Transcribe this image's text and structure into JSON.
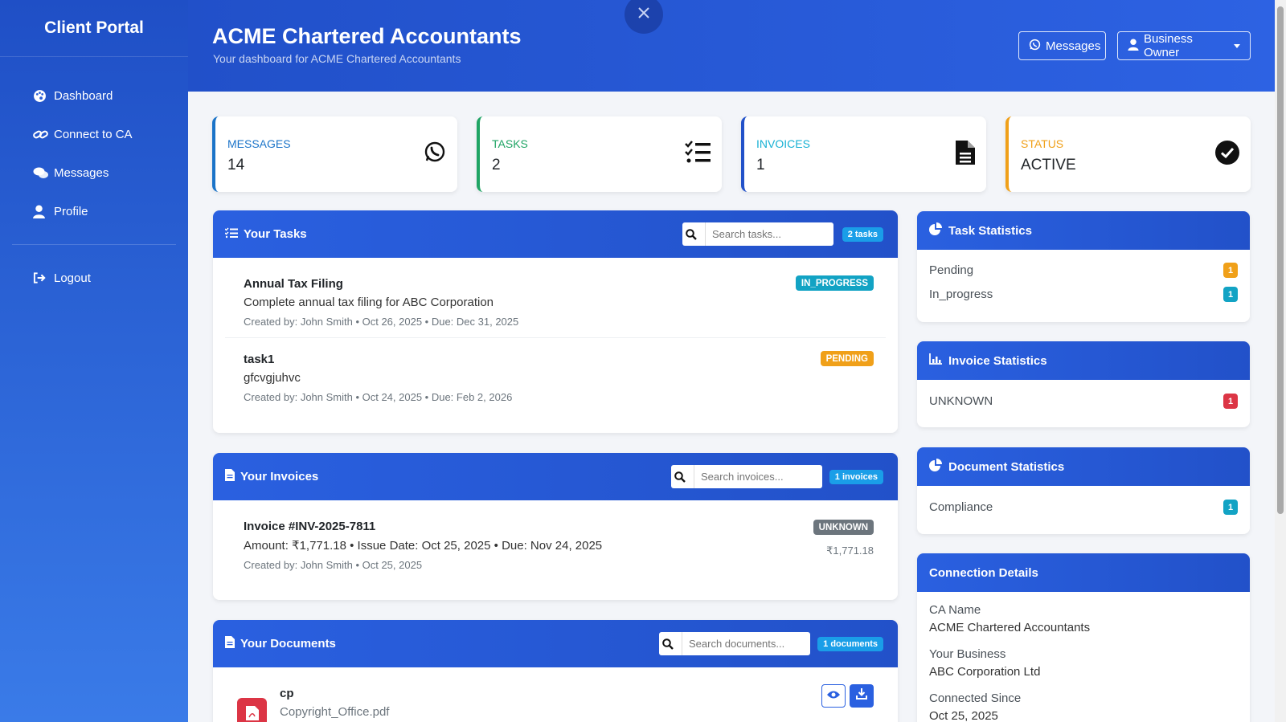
{
  "sidebar": {
    "brand": "Client Portal",
    "items": [
      {
        "label": "Dashboard",
        "icon": "palette-icon"
      },
      {
        "label": "Connect to CA",
        "icon": "link-icon"
      },
      {
        "label": "Messages",
        "icon": "comments-icon"
      },
      {
        "label": "Profile",
        "icon": "user-icon"
      }
    ],
    "logout": "Logout"
  },
  "header": {
    "title": "ACME Chartered Accountants",
    "subtitle": "Your dashboard for ACME Chartered Accountants",
    "messages_btn": "Messages",
    "user_btn": "Business Owner"
  },
  "stats": [
    {
      "label": "MESSAGES",
      "value": "14",
      "color": "#1a73c8",
      "icon": "whatsapp-icon"
    },
    {
      "label": "TASKS",
      "value": "2",
      "color": "#20a565",
      "icon": "tasks-icon"
    },
    {
      "label": "INVOICES",
      "value": "1",
      "color": "#17b1d4",
      "icon": "invoice-icon"
    },
    {
      "label": "STATUS",
      "value": "ACTIVE",
      "color": "#f0a019",
      "icon": "check-circle-icon"
    }
  ],
  "tasks": {
    "title": "Your Tasks",
    "search_placeholder": "Search tasks...",
    "count": "2 tasks",
    "items": [
      {
        "title": "Annual Tax Filing",
        "desc": "Complete annual tax filing for ABC Corporation",
        "meta": "Created by: John Smith • Oct 26, 2025 • Due: Dec 31, 2025",
        "status": "IN_PROGRESS",
        "status_color": "#12a3c4"
      },
      {
        "title": "task1",
        "desc": "gfcvgjuhvc",
        "meta": "Created by: John Smith • Oct 24, 2025 • Due: Feb 2, 2026",
        "status": "PENDING",
        "status_color": "#f0a019"
      }
    ]
  },
  "invoices": {
    "title": "Your Invoices",
    "search_placeholder": "Search invoices...",
    "count": "1 invoices",
    "items": [
      {
        "title": "Invoice #INV-2025-7811",
        "desc": "Amount: ₹1,771.18 • Issue Date: Oct 25, 2025 • Due: Nov 24, 2025",
        "meta": "Created by: John Smith • Oct 25, 2025",
        "status": "UNKNOWN",
        "status_color": "#6c757d",
        "amount": "₹1,771.18"
      }
    ]
  },
  "documents": {
    "title": "Your Documents",
    "search_placeholder": "Search documents...",
    "count": "1 documents",
    "items": [
      {
        "title": "cp",
        "file": "Copyright_Office.pdf"
      }
    ]
  },
  "task_stats": {
    "title": "Task Statistics",
    "rows": [
      {
        "label": "Pending",
        "value": "1",
        "color": "#f0a019"
      },
      {
        "label": "In_progress",
        "value": "1",
        "color": "#12a3c4"
      }
    ]
  },
  "invoice_stats": {
    "title": "Invoice Statistics",
    "rows": [
      {
        "label": "UNKNOWN",
        "value": "1",
        "color": "#dc3545"
      }
    ]
  },
  "document_stats": {
    "title": "Document Statistics",
    "rows": [
      {
        "label": "Compliance",
        "value": "1",
        "color": "#12a3c4"
      }
    ]
  },
  "connection": {
    "title": "Connection Details",
    "ca_label": "CA Name",
    "ca_value": "ACME Chartered Accountants",
    "biz_label": "Your Business",
    "biz_value": "ABC Corporation Ltd",
    "since_label": "Connected Since",
    "since_value": "Oct 25, 2025"
  }
}
